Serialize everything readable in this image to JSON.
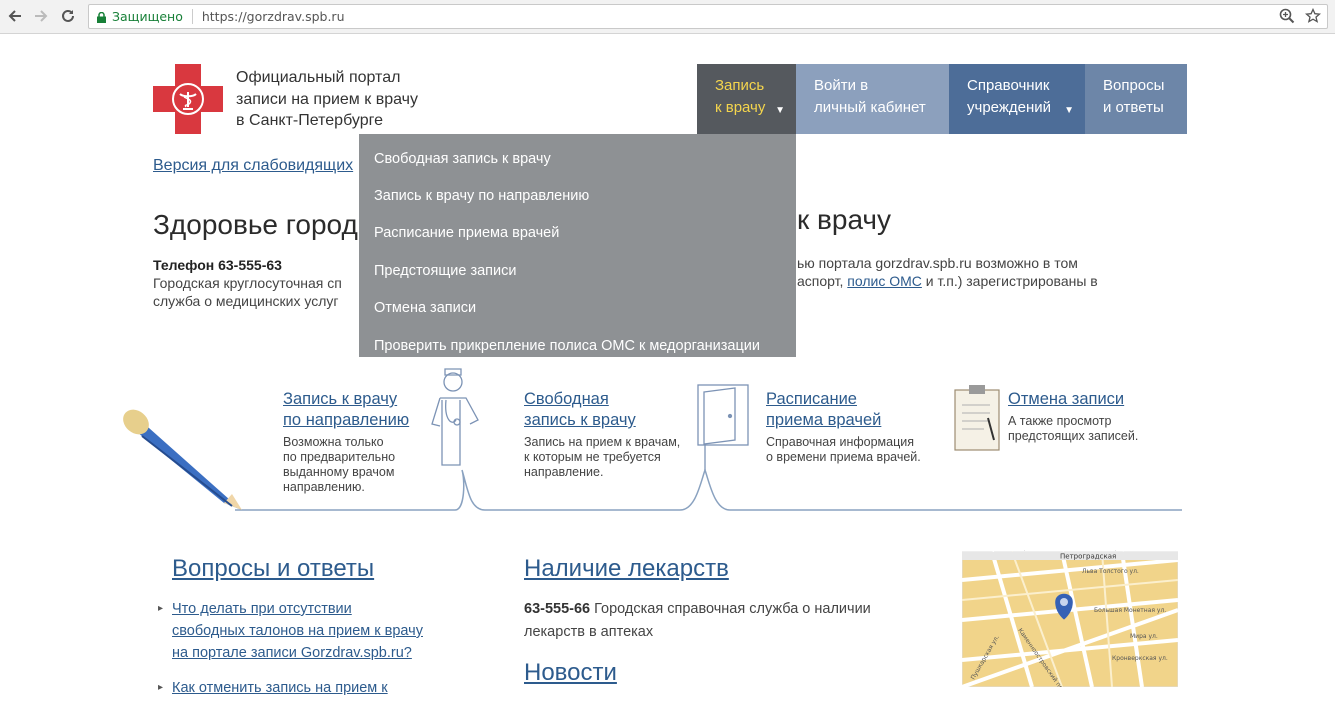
{
  "browser": {
    "secure_label": "Защищено",
    "url": "https://gorzdrav.spb.ru"
  },
  "header": {
    "portal_title": "Официальный портал\nзаписи на прием к врачу\nв Санкт-Петербурге",
    "low_vision_link": "Версия для слабовидящих"
  },
  "menu": [
    {
      "label": "Запись\nк врачу",
      "arrow": "▼"
    },
    {
      "label": "Войти в\nличный кабинет"
    },
    {
      "label": "Справочник\nучреждений",
      "arrow": "▼"
    },
    {
      "label": "Вопросы\nи ответы"
    }
  ],
  "dropdown": [
    "Свободная запись к врачу",
    "Запись к врачу по направлению",
    "Расписание приема врачей",
    "Предстоящие записи",
    "Отмена записи",
    "Проверить прикрепление полиса ОМС к медорганизации"
  ],
  "intro": {
    "heading_left": "Здоровье город",
    "heading_right": "к врачу",
    "phone": "Телефон 63-555-63",
    "service": "Городская круглосуточная сп\nслужба о медицинских услуг",
    "right_text_1": "ью портала gorzdrav.spb.ru возможно в том",
    "right_text_2": "аспорт, ",
    "right_link": "полис ОМС",
    "right_text_3": " и т.п.) зарегистрированы в"
  },
  "features": [
    {
      "title": "Запись к врачу\nпо направлению",
      "desc": "Возможна только\nпо предварительно\nвыданному врачом\nнаправлению."
    },
    {
      "title": "Свободная\nзапись к врачу",
      "desc": "Запись на прием к врачам,\nк которым не требуется\nнаправление."
    },
    {
      "title": "Расписание\nприема врачей",
      "desc": "Справочная информация\nо времени приема врачей."
    },
    {
      "title": "Отмена записи",
      "desc": "А также просмотр\nпредстоящих записей."
    }
  ],
  "faq": {
    "heading": "Вопросы и ответы",
    "items": [
      "Что делать при отсутствии\nсвободных талонов на прием к врачу\nна портале записи Gorzdrav.spb.ru?",
      "Как отменить запись на прием к"
    ]
  },
  "meds": {
    "heading": "Наличие лекарств",
    "phone": "63-555-66",
    "text": " Городская справочная служба о наличии лекарств в аптеках"
  },
  "news": {
    "heading": "Новости"
  },
  "map": {
    "streets": [
      "Петроградская",
      "Льва Толстого ул.",
      "Большая Монетная ул.",
      "Каменноостровский пр.",
      "Мира ул.",
      "Пушкарская ул.",
      "Кронверкская ул."
    ]
  },
  "colors": {
    "menu_active": "#55595e",
    "menu_active_text": "#f4d54d",
    "link": "#2d5b8d",
    "dropdown_bg": "#8e9194",
    "logo_red": "#d9383f"
  }
}
